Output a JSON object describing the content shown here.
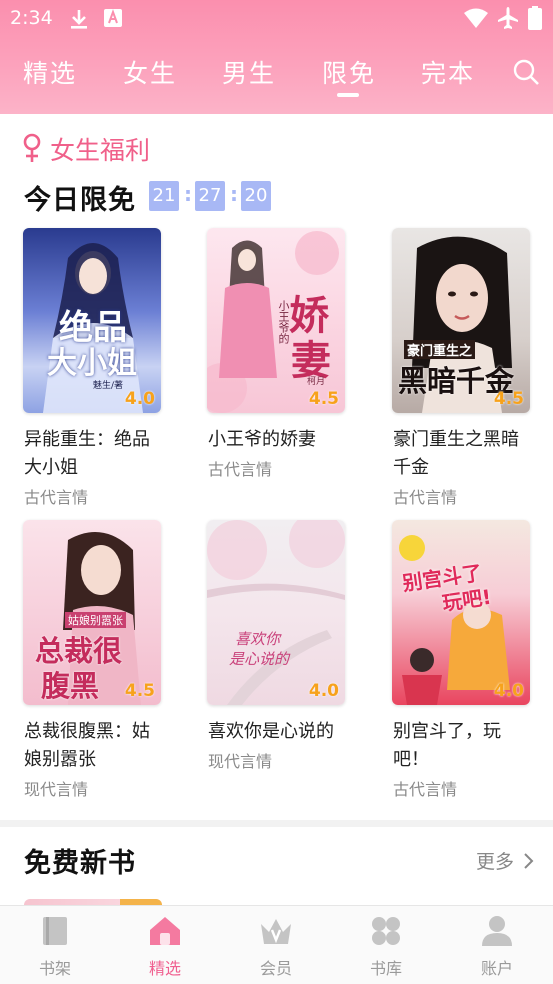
{
  "status_bar": {
    "time": "2:34",
    "icons": [
      "download-icon",
      "font-app-icon",
      "wifi-icon",
      "airplane-icon",
      "battery-icon"
    ]
  },
  "top_tabs": [
    {
      "label": "精选",
      "active": false
    },
    {
      "label": "女生",
      "active": false
    },
    {
      "label": "男生",
      "active": false
    },
    {
      "label": "限免",
      "active": true
    },
    {
      "label": "完本",
      "active": false
    }
  ],
  "section": {
    "tag_icon": "female-icon",
    "tag_label": "女生福利",
    "title": "今日限免",
    "countdown": {
      "hours": "21",
      "minutes": "27",
      "seconds": "20",
      "separator": ":"
    }
  },
  "books": [
    {
      "title": "异能重生：绝品大小姐",
      "category": "古代言情",
      "rating": "4.0"
    },
    {
      "title": "小王爷的娇妻",
      "category": "古代言情",
      "rating": "4.5"
    },
    {
      "title": "豪门重生之黑暗千金",
      "category": "古代言情",
      "rating": "4.5"
    },
    {
      "title": "总裁很腹黑：姑娘别嚣张",
      "category": "现代言情",
      "rating": "4.5"
    },
    {
      "title": "喜欢你是心说的",
      "category": "现代言情",
      "rating": "4.0"
    },
    {
      "title": "别宫斗了，玩吧！",
      "category": "古代言情",
      "rating": "4.0"
    }
  ],
  "covers": {
    "1": {
      "line1": "绝品",
      "line2": "大小姐",
      "author": "魅生/著"
    },
    "2": {
      "line1": "娇",
      "line2": "妻",
      "side": "小王爷的",
      "author": "柯月"
    },
    "3": {
      "line1": "豪门重生之",
      "line2": "黑暗千金"
    },
    "4": {
      "line1": "姑娘别嚣张",
      "line2": "总裁很",
      "line3": "腹黑"
    },
    "5": {
      "line1": "喜欢你",
      "line2": "是心说的"
    },
    "6": {
      "line1": "别宫斗了",
      "line2": "玩吧!"
    }
  },
  "free_section": {
    "title": "免费新书",
    "more_label": "更多"
  },
  "bottom_nav": [
    {
      "label": "书架",
      "icon": "bookshelf-icon",
      "active": false
    },
    {
      "label": "精选",
      "icon": "home-icon",
      "active": true
    },
    {
      "label": "会员",
      "icon": "crown-icon",
      "active": false
    },
    {
      "label": "书库",
      "icon": "library-icon",
      "active": false
    },
    {
      "label": "账户",
      "icon": "user-icon",
      "active": false
    }
  ],
  "colors": {
    "accent_pink": "#f06090",
    "header_gradient_top": "#fb8fae",
    "timer_blue": "#a8b8f5",
    "rating_orange": "#f7a21b"
  }
}
